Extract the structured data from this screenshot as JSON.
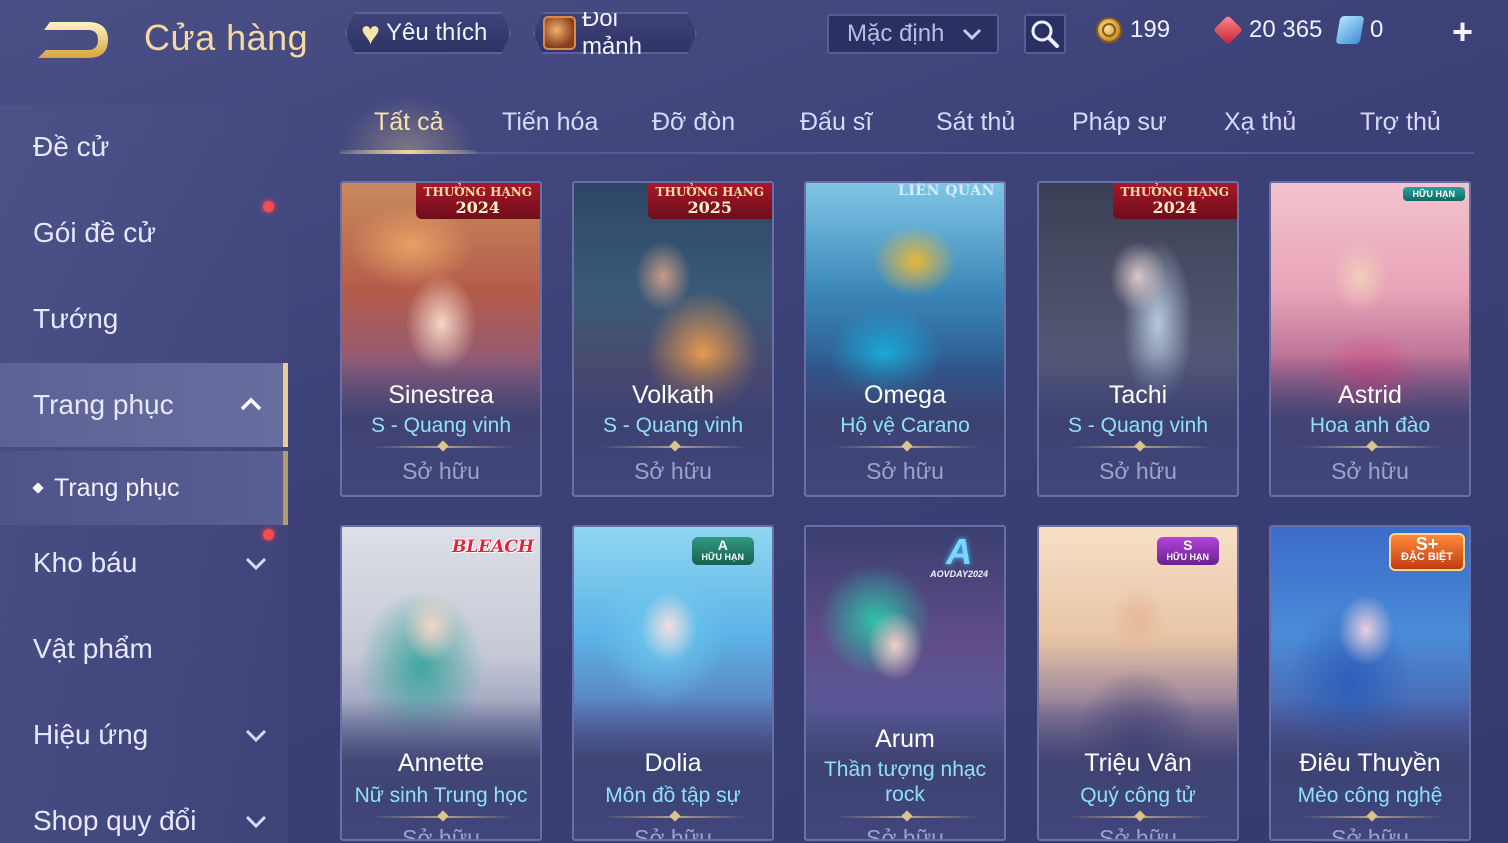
{
  "header": {
    "title": "Cửa hàng",
    "favorites_label": "Yêu thích",
    "exchange_label": "Đổi mảnh",
    "sort": {
      "selected": "Mặc định"
    },
    "currencies": [
      {
        "icon": "gold-coin-icon",
        "amount": "199"
      },
      {
        "icon": "ruby-icon",
        "amount": "20 365"
      },
      {
        "icon": "voucher-icon",
        "amount": "0"
      }
    ]
  },
  "sidebar": {
    "items": [
      {
        "label": "Đề cử"
      },
      {
        "label": "Gói đề cử"
      },
      {
        "label": "Tướng"
      },
      {
        "label": "Trang phục"
      },
      {
        "label": "Kho báu"
      },
      {
        "label": "Vật phẩm"
      },
      {
        "label": "Hiệu ứng"
      },
      {
        "label": "Shop quy đổi"
      }
    ],
    "sub_item": {
      "label": "Trang phục"
    }
  },
  "tabs": [
    "Tất cả",
    "Tiến hóa",
    "Đỡ đòn",
    "Đấu sĩ",
    "Sát thủ",
    "Pháp sư",
    "Xạ thủ",
    "Trợ thủ"
  ],
  "cards": [
    {
      "hero": "Sinestrea",
      "skin": "S - Quang vinh",
      "status": "Sở hữu",
      "badge": {
        "line1": "THƯỞNG HẠNG",
        "line2": "2024"
      }
    },
    {
      "hero": "Volkath",
      "skin": "S - Quang vinh",
      "status": "Sở hữu",
      "badge": {
        "line1": "THƯỞNG HẠNG",
        "line2": "2025"
      }
    },
    {
      "hero": "Omega",
      "skin": "Hộ vệ Carano",
      "status": "Sở hữu",
      "brand": "LIÊN QUÂN"
    },
    {
      "hero": "Tachi",
      "skin": "S - Quang vinh",
      "status": "Sở hữu",
      "badge": {
        "line1": "THƯỞNG HẠNG",
        "line2": "2024"
      }
    },
    {
      "hero": "Astrid",
      "skin": "Hoa anh đào",
      "status": "Sở hữu",
      "tag": "HỮU HẠN"
    },
    {
      "hero": "Annette",
      "skin": "Nữ sinh Trung học",
      "status": "Sở hữu",
      "brand": "BLEACH"
    },
    {
      "hero": "Dolia",
      "skin": "Môn đồ tập sự",
      "status": "Sở hữu",
      "tier": {
        "grade": "A",
        "label": "HỮU HẠN"
      }
    },
    {
      "hero": "Arum",
      "skin": "Thần tượng nhạc rock",
      "status": "Sở hữu",
      "aov": {
        "mark": "A",
        "label": "AOVDAY2024"
      }
    },
    {
      "hero": "Triệu Vân",
      "skin": "Quý công tử",
      "status": "Sở hữu",
      "tier": {
        "grade": "S",
        "label": "HỮU HẠN"
      }
    },
    {
      "hero": "Điêu Thuyền",
      "skin": "Mèo công nghệ",
      "status": "Sở hữu",
      "splus": {
        "grade": "S+",
        "label": "ĐẶC BIỆT"
      }
    }
  ]
}
